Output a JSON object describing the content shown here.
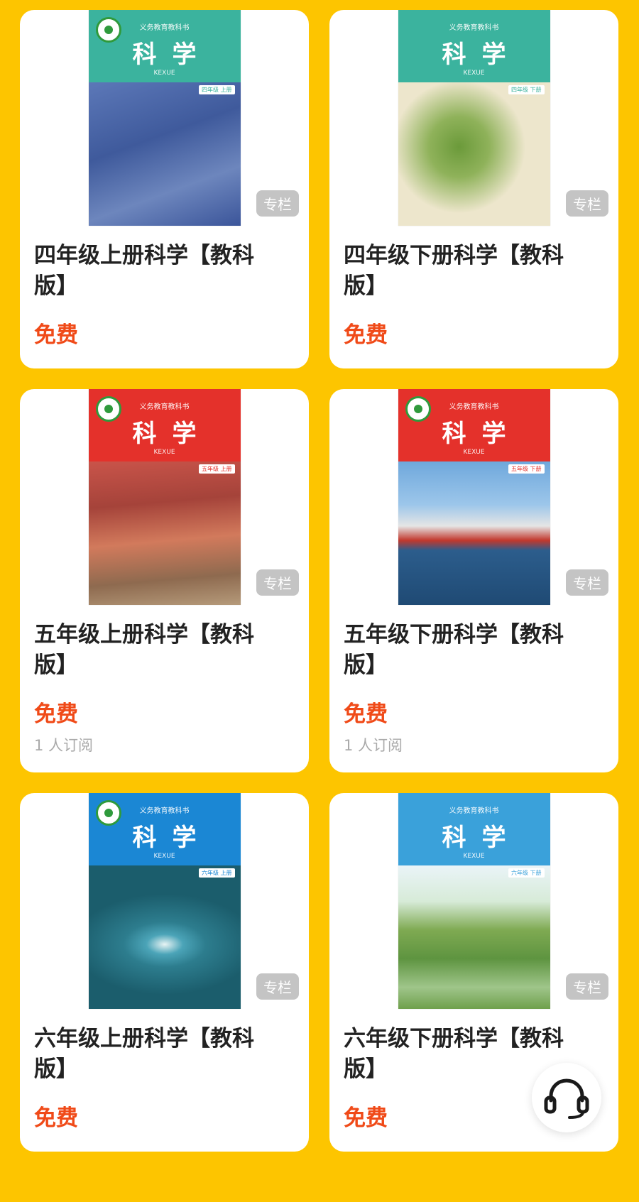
{
  "courses": [
    {
      "cover": {
        "series": "义务教育教科书",
        "title": "科学",
        "pinyin": "KEXUE",
        "grade": "四年级  上册",
        "head_color": "#3BB39E",
        "body_color": "#4A63A8"
      },
      "tag": "专栏",
      "title": "四年级上册科学【教科版】",
      "price": "免费",
      "subscribers": ""
    },
    {
      "cover": {
        "series": "义务教育教科书",
        "title": "科学",
        "pinyin": "KEXUE",
        "grade": "四年级  下册",
        "head_color": "#3BB39E",
        "body_color": "#E9E1C6"
      },
      "tag": "专栏",
      "title": "四年级下册科学【教科版】",
      "price": "免费",
      "subscribers": ""
    },
    {
      "cover": {
        "series": "义务教育教科书",
        "title": "科学",
        "pinyin": "KEXUE",
        "grade": "五年级  上册",
        "head_color": "#E4312B",
        "body_color": "#B24A3D"
      },
      "tag": "专栏",
      "title": "五年级上册科学【教科版】",
      "price": "免费",
      "subscribers": "1 人订阅"
    },
    {
      "cover": {
        "series": "义务教育教科书",
        "title": "科学",
        "pinyin": "KEXUE",
        "grade": "五年级  下册",
        "head_color": "#E4312B",
        "body_color": "#4A86C4"
      },
      "tag": "专栏",
      "title": "五年级下册科学【教科版】",
      "price": "免费",
      "subscribers": "1 人订阅"
    },
    {
      "cover": {
        "series": "义务教育教科书",
        "title": "科学",
        "pinyin": "KEXUE",
        "grade": "六年级  上册",
        "head_color": "#1B87D4",
        "body_color": "#1E5F6E"
      },
      "tag": "专栏",
      "title": "六年级上册科学【教科版】",
      "price": "免费",
      "subscribers": ""
    },
    {
      "cover": {
        "series": "义务教育教科书",
        "title": "科学",
        "pinyin": "KEXUE",
        "grade": "六年级  下册",
        "head_color": "#3AA1DA",
        "body_color": "#7CA65A"
      },
      "tag": "专栏",
      "title": "六年级下册科学【教科版】",
      "price": "免费",
      "subscribers": ""
    }
  ],
  "support_button": {
    "icon": "headset-icon"
  },
  "colors": {
    "background": "#FDC500",
    "price": "#F04A18",
    "tag": "#C4C4C4"
  }
}
